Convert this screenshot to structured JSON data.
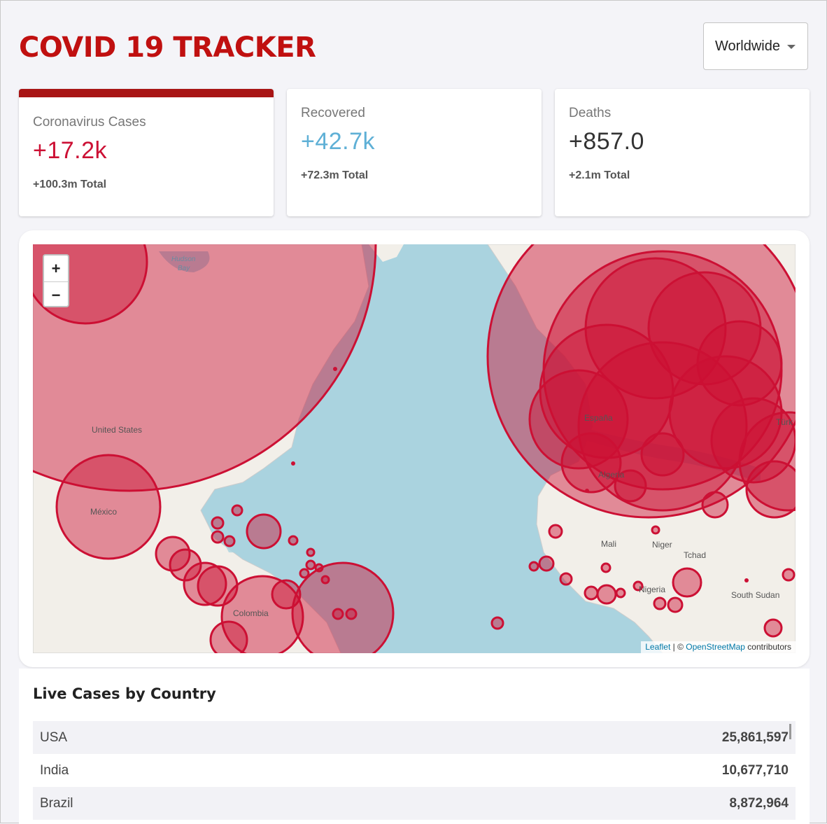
{
  "header": {
    "title": "COVID 19 TRACKER",
    "country_select": "Worldwide"
  },
  "stats": {
    "cases": {
      "label": "Coronavirus Cases",
      "value": "+17.2k",
      "total": "+100.3m Total",
      "color": "#cc1034"
    },
    "recovered": {
      "label": "Recovered",
      "value": "+42.7k",
      "total": "+72.3m Total",
      "color": "#5fb0d6"
    },
    "deaths": {
      "label": "Deaths",
      "value": "+857.0",
      "total": "+2.1m Total",
      "color": "#333333"
    }
  },
  "map": {
    "zoom_in": "+",
    "zoom_out": "−",
    "attribution": {
      "leaflet": "Leaflet",
      "separator": " | © ",
      "osm": "OpenStreetMap",
      "suffix": " contributors"
    },
    "place_labels": [
      "Hudson Bay",
      "United States",
      "México",
      "Colombia",
      "Mali",
      "Niger",
      "Tchad",
      "South Sudan",
      "Nigeria",
      "Algeria",
      "España",
      "Türk"
    ]
  },
  "table": {
    "title": "Live Cases by Country",
    "rows": [
      {
        "country": "USA",
        "cases": "25,861,597"
      },
      {
        "country": "India",
        "cases": "10,677,710"
      },
      {
        "country": "Brazil",
        "cases": "8,872,964"
      }
    ]
  },
  "colors": {
    "accent": "#c01010",
    "circle": "#cc1034"
  }
}
